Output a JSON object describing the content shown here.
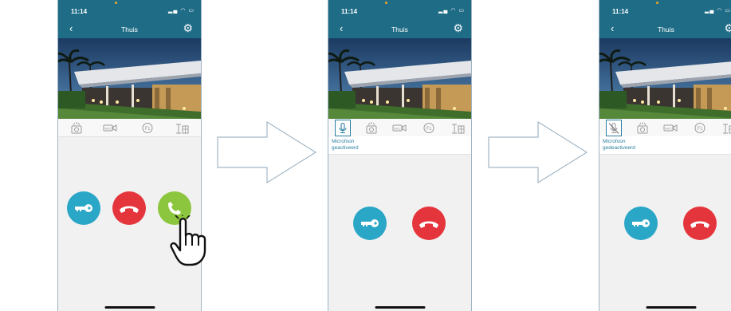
{
  "caption": "",
  "status_time": "11:14",
  "nav_title": "Thuis",
  "mic_activated_label": "Microfoon geactiveerd",
  "mic_deactivated_label": "Microfoon gedeactiveerd",
  "toolbar_icons": [
    "snapshot-icon",
    "record-icon",
    "f1-icon",
    "gate-icon"
  ],
  "mic_icons": [
    "microphone-icon",
    "microphone-muted-icon"
  ],
  "call_buttons": [
    "unlock-key-button",
    "hang-up-button",
    "answer-call-button"
  ],
  "colors": {
    "header": "#1e6c86",
    "accent": "#2b7fa0",
    "key": "#2aa6c7",
    "hangup": "#e5353c",
    "answer": "#8cc63e"
  }
}
